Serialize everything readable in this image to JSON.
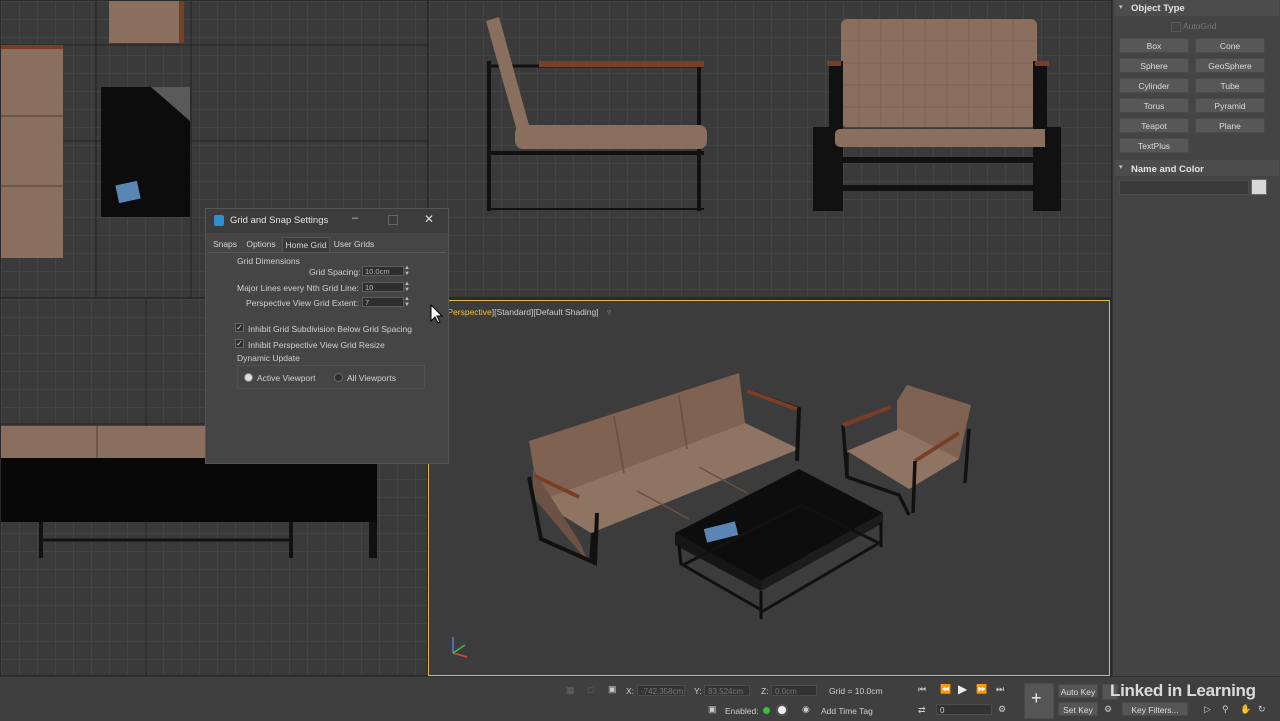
{
  "colors": {
    "active_viewport_border": "#e6b84a",
    "label_yellow": "#f0c040",
    "sofa": "#8a6e5e",
    "wood": "#7a3e26",
    "frame": "#111111"
  },
  "dialog": {
    "title": "Grid and Snap Settings",
    "tabs": [
      "Snaps",
      "Options",
      "Home Grid",
      "User Grids"
    ],
    "active_tab": "Home Grid",
    "group_title": "Grid Dimensions",
    "grid_spacing_label": "Grid Spacing:",
    "grid_spacing_value": "10.0cm",
    "major_lines_label": "Major Lines every Nth Grid Line:",
    "major_lines_value": "10",
    "perspective_extent_label": "Perspective View Grid Extent:",
    "perspective_extent_value": "7",
    "inhibit_subdivision_label": "Inhibit Grid Subdivision Below Grid Spacing",
    "inhibit_resize_label": "Inhibit Perspective View Grid Resize",
    "dynamic_update_label": "Dynamic Update",
    "active_viewport_label": "Active Viewport",
    "all_viewports_label": "All Viewports",
    "inhibit_subdivision_checked": true,
    "inhibit_resize_checked": true,
    "dynamic_update_selected": "Active Viewport"
  },
  "viewport": {
    "label_name": "Perspective",
    "label_view": "Standard",
    "label_shading": "Default Shading"
  },
  "right_panel": {
    "object_type_title": "Object Type",
    "autogrid_label": "AutoGrid",
    "buttons": [
      "Box",
      "Cone",
      "Sphere",
      "GeoSphere",
      "Cylinder",
      "Tube",
      "Torus",
      "Pyramid",
      "Teapot",
      "Plane",
      "TextPlus"
    ],
    "name_color_title": "Name and Color"
  },
  "status": {
    "x_label": "X:",
    "x_value": "-742.358cm",
    "y_label": "Y:",
    "y_value": "83.524cm",
    "z_label": "Z:",
    "z_value": "0.0cm",
    "grid_text": "Grid = 10.0cm",
    "enabled_label": "Enabled:",
    "add_time_tag": "Add Time Tag",
    "auto_key": "Auto Key",
    "set_key": "Set Key",
    "key_filters": "Key Filters...",
    "frame_value": "0",
    "watermark": "Linked in Learning"
  }
}
